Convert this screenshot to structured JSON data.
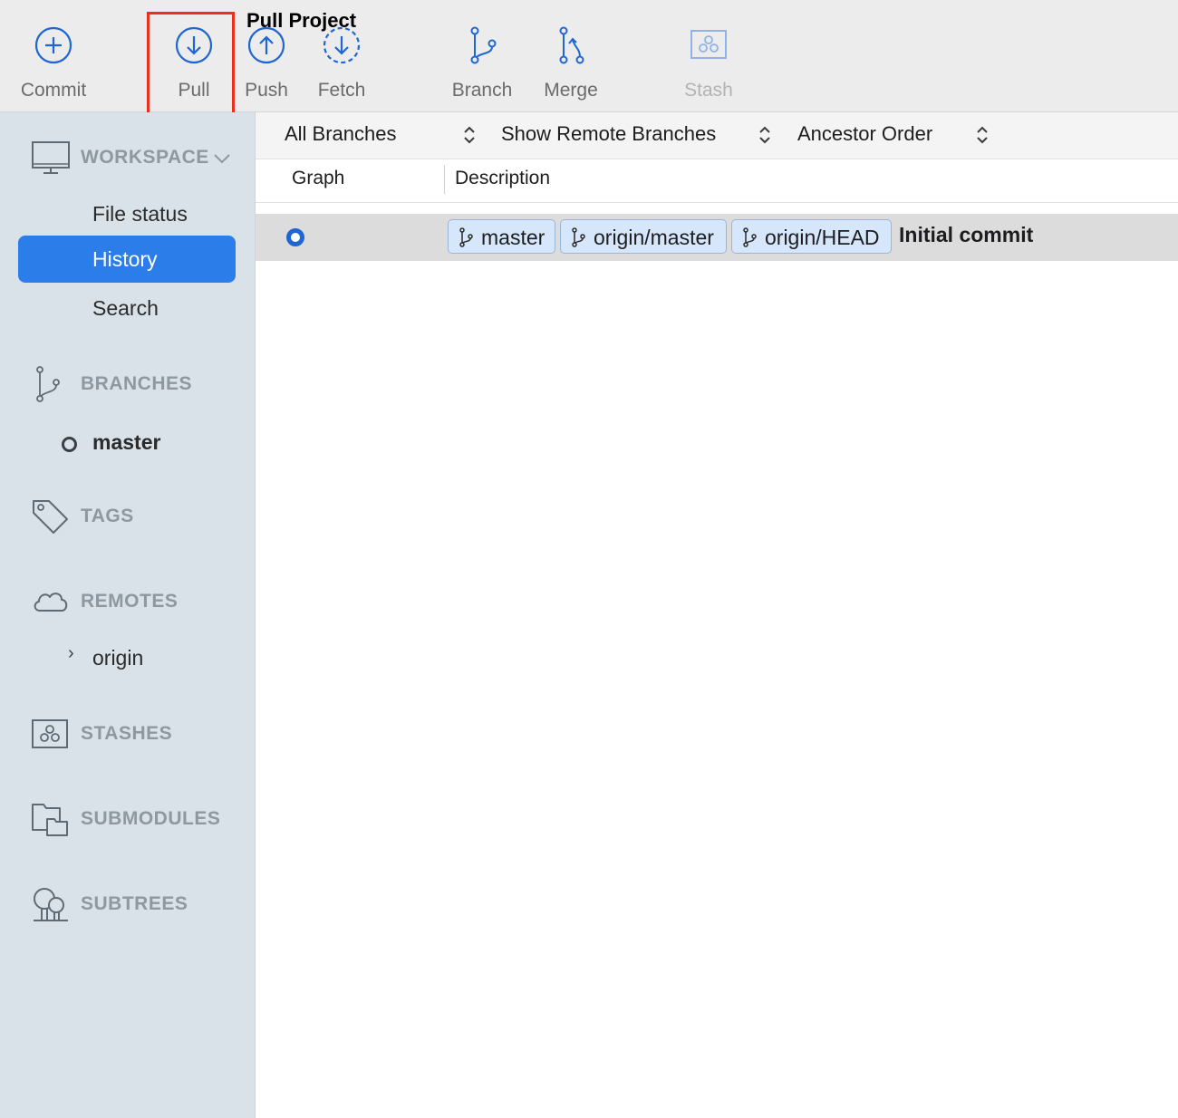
{
  "toolbar": {
    "tooltip": "Pull Project",
    "buttons": {
      "commit": {
        "label": "Commit",
        "icon": "plus-circle-icon"
      },
      "pull": {
        "label": "Pull",
        "icon": "pull-arrow-down-icon"
      },
      "push": {
        "label": "Push",
        "icon": "push-arrow-up-icon"
      },
      "fetch": {
        "label": "Fetch",
        "icon": "fetch-dashed-arrow-icon"
      },
      "branch": {
        "label": "Branch",
        "icon": "branch-icon"
      },
      "merge": {
        "label": "Merge",
        "icon": "merge-icon"
      },
      "stash": {
        "label": "Stash",
        "icon": "stash-icon",
        "enabled": false
      }
    }
  },
  "sidebar": {
    "workspace": {
      "title": "WORKSPACE",
      "icon": "monitor-icon",
      "expanded": true
    },
    "workspace_items": [
      {
        "label": "File status",
        "active": false
      },
      {
        "label": "History",
        "active": true
      },
      {
        "label": "Search",
        "active": false
      }
    ],
    "branches": {
      "title": "BRANCHES",
      "icon": "branch-icon"
    },
    "branch_items": [
      {
        "label": "master",
        "current": true
      }
    ],
    "tags": {
      "title": "TAGS",
      "icon": "tag-icon"
    },
    "remotes": {
      "title": "REMOTES",
      "icon": "cloud-icon"
    },
    "remote_items": [
      {
        "label": "origin",
        "collapsed": true
      }
    ],
    "stashes": {
      "title": "STASHES",
      "icon": "stash-icon"
    },
    "submodules": {
      "title": "SUBMODULES",
      "icon": "folders-icon"
    },
    "subtrees": {
      "title": "SUBTREES",
      "icon": "trees-icon"
    }
  },
  "filters": {
    "branches": "All Branches",
    "remote": "Show Remote Branches",
    "order": "Ancestor Order"
  },
  "columns": {
    "graph": "Graph",
    "description": "Description"
  },
  "commits": [
    {
      "refs": [
        "master",
        "origin/master",
        "origin/HEAD"
      ],
      "message": "Initial commit"
    }
  ],
  "colors": {
    "accent": "#2b7de9",
    "icon_blue": "#1f66d1",
    "highlight": "#e8301c",
    "sidebar_bg": "#d9e2e8",
    "ref_tag_bg": "#d6e6fb"
  }
}
